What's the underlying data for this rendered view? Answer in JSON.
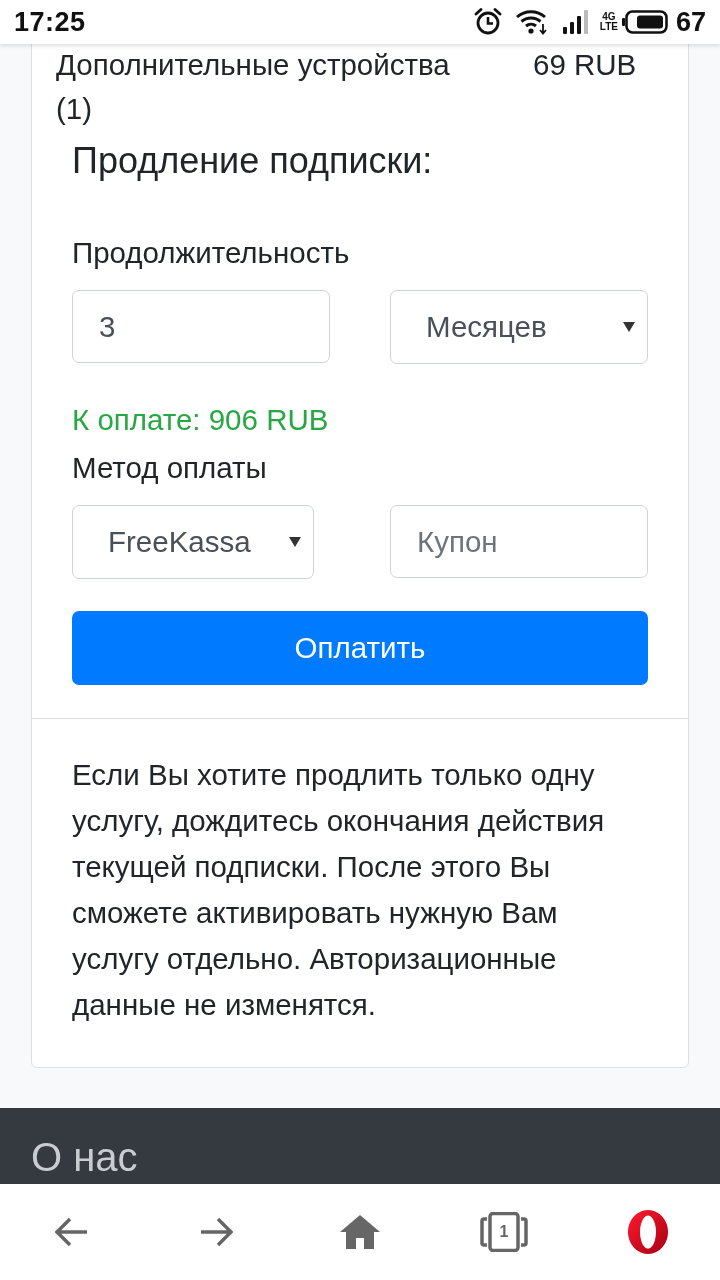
{
  "status_bar": {
    "time": "17:25",
    "network": [
      "4G",
      "LTE"
    ],
    "battery": "67"
  },
  "subscription_card": {
    "items": [
      {
        "name": "Дополнительные устройства (1)",
        "price": "69 RUB"
      }
    ],
    "renewal": {
      "title": "Продление подписки:",
      "duration_label": "Продолжительность",
      "duration_value": "3",
      "period_select": "Месяцев",
      "total": "К оплате: 906 RUB",
      "payment_label": "Метод оплаты",
      "payment_select": "FreeKassa",
      "coupon": {
        "placeholder": "Купон"
      },
      "pay_button": "Оплатить"
    },
    "note": "Если Вы хотите продлить только одну услугу, дождитесь окончания действия текущей подписки. После этого Вы сможете активировать нужную Вам услугу отдельно. Авторизационные данные не изменятся."
  },
  "footer": {
    "title": "О нас"
  },
  "browser_nav": {
    "tab_count": "1"
  }
}
